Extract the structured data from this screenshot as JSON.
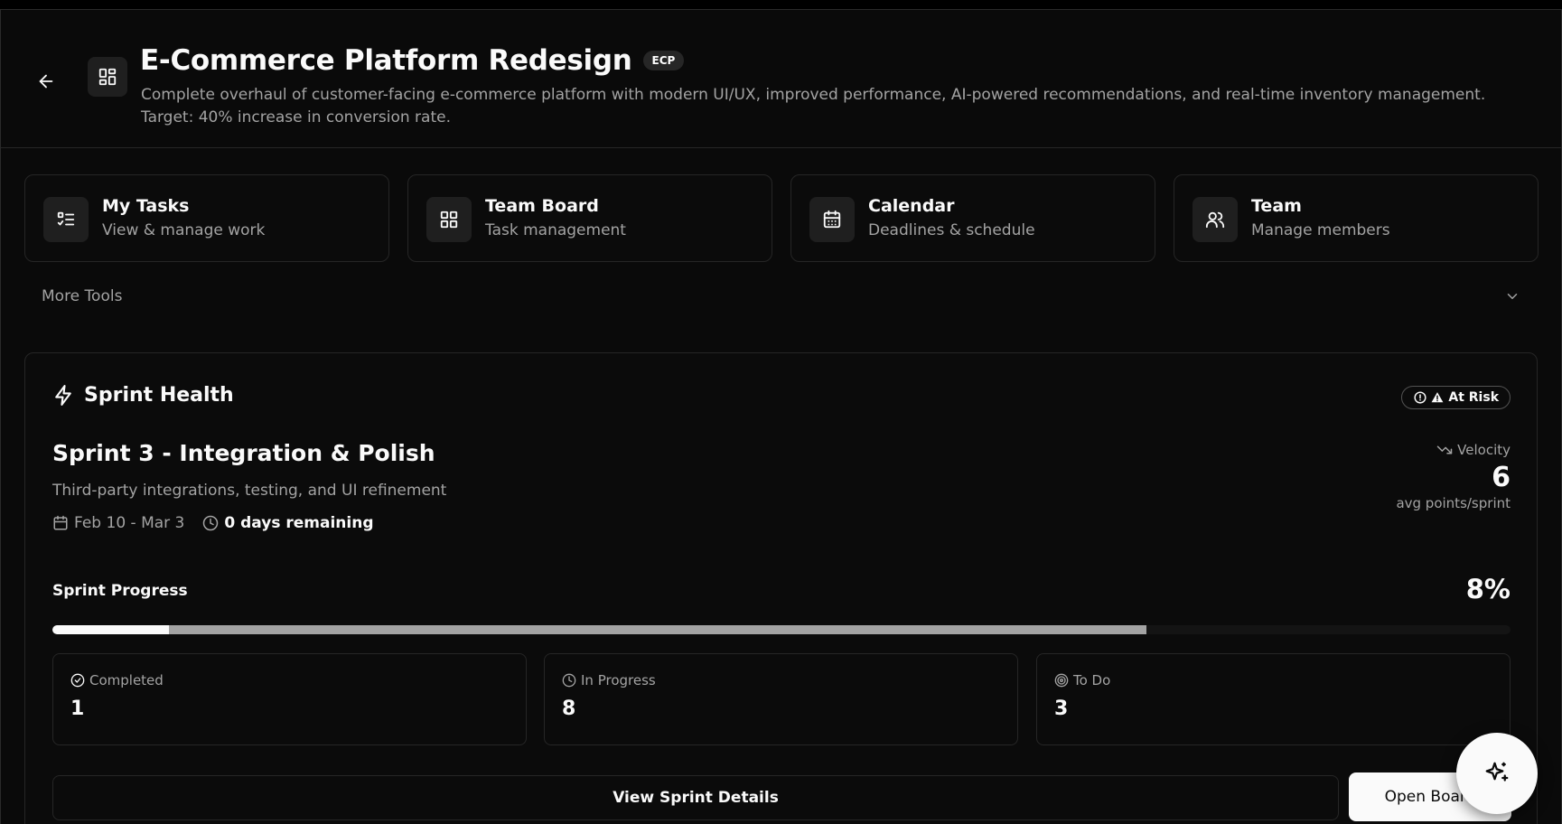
{
  "project": {
    "title": "E-Commerce Platform Redesign",
    "code": "ECP",
    "description": "Complete overhaul of customer-facing e-commerce platform with modern UI/UX, improved performance, AI-powered recommendations, and real-time inventory management. Target: 40% increase in conversion rate."
  },
  "tools": [
    {
      "title": "My Tasks",
      "subtitle": "View & manage work",
      "icon": "task-list-icon"
    },
    {
      "title": "Team Board",
      "subtitle": "Task management",
      "icon": "grid-icon"
    },
    {
      "title": "Calendar",
      "subtitle": "Deadlines & schedule",
      "icon": "calendar-icon"
    },
    {
      "title": "Team",
      "subtitle": "Manage members",
      "icon": "users-icon"
    }
  ],
  "more_tools": {
    "label": "More Tools"
  },
  "sprint_health": {
    "heading": "Sprint Health",
    "status": "At Risk",
    "sprint_name": "Sprint 3 - Integration & Polish",
    "sprint_description": "Third-party integrations, testing, and UI refinement",
    "dates": "Feb 10 - Mar 3",
    "remaining": "0 days remaining",
    "velocity": {
      "label": "Velocity",
      "value": "6",
      "unit": "avg points/sprint"
    },
    "progress": {
      "label": "Sprint Progress",
      "percent_text": "8%",
      "completed_fraction": 0.08,
      "assigned_fraction": 0.75
    },
    "stats": [
      {
        "label": "Completed",
        "value": "1",
        "icon": "check-circle-icon"
      },
      {
        "label": "In Progress",
        "value": "8",
        "icon": "clock-icon"
      },
      {
        "label": "To Do",
        "value": "3",
        "icon": "target-icon"
      }
    ],
    "view_details_label": "View Sprint Details",
    "open_board_label": "Open Board"
  },
  "colors": {
    "background": "#0a0a0a",
    "card": "#0b0b0b",
    "border": "#262626",
    "muted": "#a3a3a3",
    "foreground": "#fafafa"
  }
}
